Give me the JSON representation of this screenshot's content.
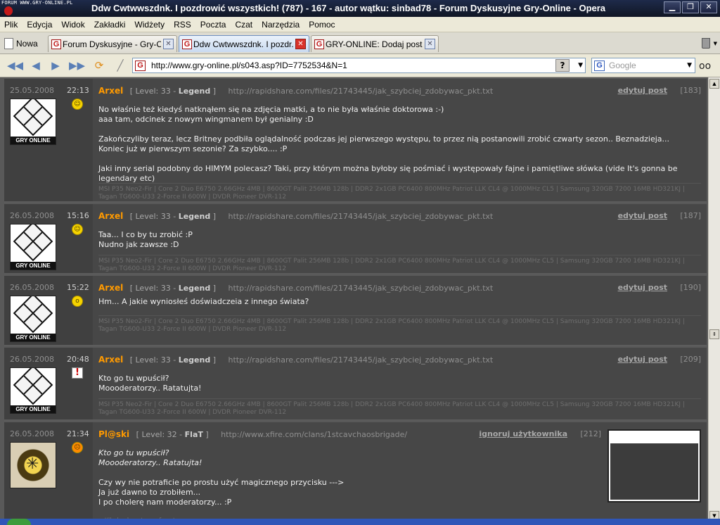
{
  "window": {
    "watermark": "FORUM WWW.GRY-ONLINE.PL",
    "title": "Ddw Cwtwwszdnk. I pozdrowić wszystkich! (787) - 167 - autor wątku: sinbad78 - Forum Dyskusyjne Gry-Online - Opera",
    "minimize": "▁",
    "restore": "❐",
    "close": "✕"
  },
  "menu": [
    "Plik",
    "Edycja",
    "Widok",
    "Zakładki",
    "Widżety",
    "RSS",
    "Poczta",
    "Czat",
    "Narzędzia",
    "Pomoc"
  ],
  "tabs": {
    "new_label": "Nowa",
    "items": [
      {
        "favicon": "G",
        "label": "Forum Dyskusyjne - Gry-O...",
        "close": "✕"
      },
      {
        "favicon": "G",
        "label": "Ddw Cwtwwszdnk. I pozdr...",
        "close": "✕"
      },
      {
        "favicon": "G",
        "label": "GRY-ONLINE: Dodaj post",
        "close": "✕"
      }
    ]
  },
  "nav": {
    "rewind": "◀◀",
    "back": "◀",
    "forward": "▶",
    "fastforward": "▶▶",
    "url_favicon": "G",
    "url": "http://www.gry-online.pl/s043.asp?ID=7752534&N=1",
    "help": "?",
    "dropdown": "▼",
    "search_favicon": "G",
    "search_placeholder": "Google",
    "glasses": "👓"
  },
  "posts": [
    {
      "date": "25.05.2008",
      "time": "22:13",
      "author": "Arxel",
      "level_prefix": "[ Level: 33 - ",
      "level_rank": "Legend",
      "level_suffix": " ]",
      "link": "http://rapidshare.com/files/21743445/jak_szybciej_zdobywac_pkt.txt",
      "action": "edytuj post",
      "number": "[183]",
      "lines": [
        "No właśnie też kiedyś natknąłem się na zdjęcia matki, a to nie była właśnie doktorowa :-)",
        "aaa tam, odcinek z nowym wingmanem był genialny :D",
        "",
        "Zakończyliby teraz, lecz Britney podbiła oglądalność podczas jej pierwszego występu, to przez nią postanowili zrobić czwarty sezon.. Beznadzieja...",
        "Koniec już w pierwszym sezonie? Za szybko.... :P",
        "",
        "Jaki inny serial podobny do HIMYM polecasz? Taki, przy którym można byłoby się pośmiać i występowały fajne i pamiętliwe słówka (vide It's gonna be legendary etc)"
      ],
      "signature": "MSI P35 Neo2-Fir | Core 2 Duo E6750 2.66GHz 4MB | 8600GT Palit 256MB 128b | DDR2 2x1GB PC6400 800MHz Patriot LLK CL4 @ 1000MHz CL5 | Samsung 320GB 7200 16MB HD321KJ | Tagan TG600-U33 2-Force II 600W | DVDR Pioneer DVR-112"
    },
    {
      "date": "26.05.2008",
      "time": "15:16",
      "author": "Arxel",
      "level_prefix": "[ Level: 33 - ",
      "level_rank": "Legend",
      "level_suffix": " ]",
      "link": "http://rapidshare.com/files/21743445/jak_szybciej_zdobywac_pkt.txt",
      "action": "edytuj post",
      "number": "[187]",
      "lines": [
        "Taa... I co by tu zrobić :P",
        "Nudno jak zawsze :D"
      ],
      "signature": "MSI P35 Neo2-Fir | Core 2 Duo E6750 2.66GHz 4MB | 8600GT Palit 256MB 128b | DDR2 2x1GB PC6400 800MHz Patriot LLK CL4 @ 1000MHz CL5 | Samsung 320GB 7200 16MB HD321KJ | Tagan TG600-U33 2-Force II 600W | DVDR Pioneer DVR-112"
    },
    {
      "date": "26.05.2008",
      "time": "15:22",
      "author": "Arxel",
      "level_prefix": "[ Level: 33 - ",
      "level_rank": "Legend",
      "level_suffix": " ]",
      "link": "http://rapidshare.com/files/21743445/jak_szybciej_zdobywac_pkt.txt",
      "action": "edytuj post",
      "number": "[190]",
      "lines": [
        "Hm... A jakie wyniosłeś doświadczeia z innego świata?"
      ],
      "signature": "MSI P35 Neo2-Fir | Core 2 Duo E6750 2.66GHz 4MB | 8600GT Palit 256MB 128b | DDR2 2x1GB PC6400 800MHz Patriot LLK CL4 @ 1000MHz CL5 | Samsung 320GB 7200 16MB HD321KJ | Tagan TG600-U33 2-Force II 600W | DVDR Pioneer DVR-112"
    },
    {
      "date": "26.05.2008",
      "time": "20:48",
      "author": "Arxel",
      "level_prefix": "[ Level: 33 - ",
      "level_rank": "Legend",
      "level_suffix": " ]",
      "link": "http://rapidshare.com/files/21743445/jak_szybciej_zdobywac_pkt.txt",
      "action": "edytuj post",
      "number": "[209]",
      "lines": [
        "Kto go tu wpuścił?",
        "Moooderatorzy.. Ratatujta!"
      ],
      "signature": "MSI P35 Neo2-Fir | Core 2 Duo E6750 2.66GHz 4MB | 8600GT Palit 256MB 128b | DDR2 2x1GB PC6400 800MHz Patriot LLK CL4 @ 1000MHz CL5 | Samsung 320GB 7200 16MB HD321KJ | Tagan TG600-U33 2-Force II 600W | DVDR Pioneer DVR-112"
    },
    {
      "date": "26.05.2008",
      "time": "21:34",
      "author": "Pl@ski",
      "level_prefix": "[ Level: 32 - ",
      "level_rank": "FlaT",
      "level_suffix": " ]",
      "link": "http://www.xfire.com/clans/1stcavchaosbrigade/",
      "action": "ignoruj użytkownika",
      "number": "[212]",
      "quote": [
        "Kto go tu wpuścił?",
        "Moooderatorzy.. Ratatujta!"
      ],
      "lines": [
        "",
        "Czy wy nie potraficie po prostu użyć magicznego przycisku --->",
        "Ja już dawno to zrobiłem...",
        "I po cholerę nam moderatorzy... :P"
      ],
      "signature": "...I'll shed no tears for strangers..."
    }
  ],
  "avatar_logo": "GRY ONLINE",
  "emoticons": {
    "smile": "☺",
    "wow": "o",
    "warning": "!",
    "angry": "☹"
  },
  "scrollbar": {
    "up": "▲",
    "mid": "⇕",
    "down": "▼"
  }
}
